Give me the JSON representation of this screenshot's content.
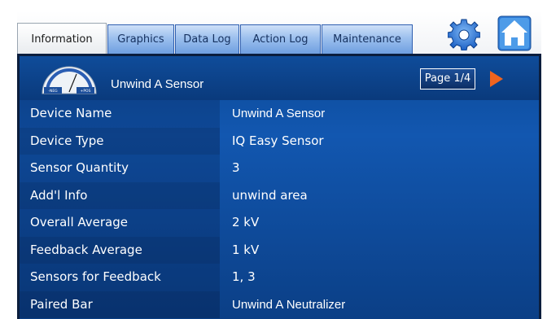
{
  "tabs": [
    {
      "label": "Information",
      "active": true
    },
    {
      "label": "Graphics",
      "active": false
    },
    {
      "label": "Data Log",
      "active": false
    },
    {
      "label": "Action Log",
      "active": false
    },
    {
      "label": "Maintenance",
      "active": false
    }
  ],
  "icons": {
    "settings": "gear-icon",
    "home": "home-icon",
    "next": "next-arrow-icon",
    "gauge": "gauge-icon"
  },
  "gauge": {
    "neg_label": "-NEG",
    "pos_label": "+POS"
  },
  "header": {
    "sensor_name": "Unwind A Sensor",
    "page_label": "Page 1/4"
  },
  "info_rows": [
    {
      "label": "Device Name",
      "value": "Unwind A Sensor"
    },
    {
      "label": "Device Type",
      "value": "IQ Easy Sensor"
    },
    {
      "label": "Sensor Quantity",
      "value": "3"
    },
    {
      "label": "Add'l Info",
      "value": "unwind area"
    },
    {
      "label": "Overall Average",
      "value": "2 kV"
    },
    {
      "label": "Feedback Average",
      "value": "1 kV"
    },
    {
      "label": "Sensors for Feedback",
      "value": "1, 3"
    },
    {
      "label": "Paired Bar",
      "value": "Unwind A Neutralizer"
    }
  ],
  "colors": {
    "panel_blue": "#1257b0",
    "tab_blue": "#9cc0ee",
    "accent_orange": "#f0641e",
    "home_blue": "#3f8fe0"
  }
}
